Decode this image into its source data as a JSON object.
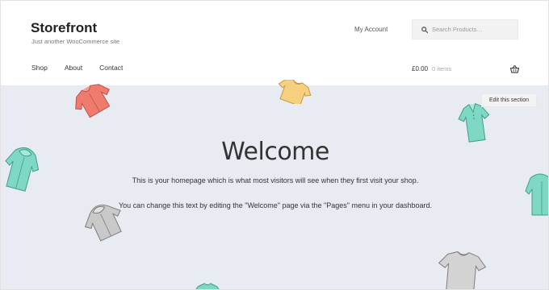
{
  "header": {
    "site_title": "Storefront",
    "tagline": "Just another WooCommerce site",
    "my_account": "My Account",
    "search_placeholder": "Search Products…",
    "nav": [
      "Shop",
      "About",
      "Contact"
    ],
    "cart_amount": "£0.00",
    "cart_count": "0 items"
  },
  "hero": {
    "edit_label": "Edit this section",
    "title": "Welcome",
    "paragraph_1": "This is your homepage which is what most visitors will see when they first visit your shop.",
    "paragraph_2": "You can change this text by editing the \"Welcome\" page via the \"Pages\" menu in your dashboard."
  },
  "icons": {
    "search": "search-icon",
    "cart": "basket-icon",
    "decorations": [
      "red-hoodie-icon",
      "yellow-tshirt-icon",
      "teal-polo-icon",
      "teal-hoodie-icon",
      "grey-hoodie-icon",
      "grey-tshirt-icon",
      "green-tshirt-icon"
    ]
  },
  "colors": {
    "hero_background": "#e8ecf2",
    "red_hoodie": "#ef7b6e",
    "yellow_tshirt": "#f6cf7f",
    "teal": "#7fd8c3",
    "grey": "#b8b8b8"
  }
}
